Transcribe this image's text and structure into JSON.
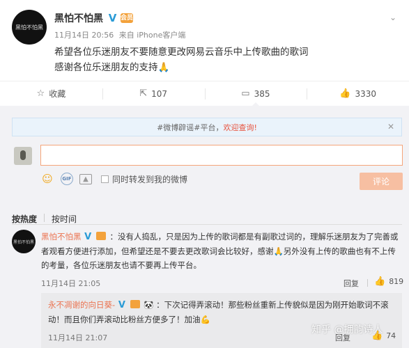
{
  "post": {
    "avatar_text": "黑怕不怕黑",
    "author": "黑怕不怕黑",
    "verified_mark": "V",
    "level_badge": "会员",
    "timestamp": "11月14日 20:56",
    "source_prefix": "来自",
    "source": "iPhone客户端",
    "line1": "希望各位乐迷朋友不要随意更改网易云音乐中上传歌曲的歌词",
    "line2": "感谢各位乐迷朋友的支持🙏",
    "menu_icon": "chevron-down-icon"
  },
  "actions": {
    "favorite_label": "收藏",
    "repost_count": "107",
    "comment_count": "385",
    "like_count": "3330"
  },
  "notice": {
    "prefix": "#微博辟谣#平台，",
    "link": "欢迎查询!",
    "close": "✕"
  },
  "composer": {
    "input_value": "",
    "repost_label": "同时转发到我的微博",
    "submit_label": "评论"
  },
  "sort": {
    "by_hot": "按热度",
    "by_time": "按时间"
  },
  "comment": {
    "author": "黑怕不怕黑",
    "text": "：没有人捣乱，只是因为上传的歌词都是有副歌过词的，理解乐迷朋友为了完善或者观看方便进行添加，但希望还是不要去更改歌词会比较好，感谢🙏另外没有上传的歌曲也有不上传的考量，各位乐迷朋友也请不要再上传平台。",
    "time": "11月14日 21:05",
    "reply_label": "回复",
    "like_count": "819"
  },
  "sub_comment": {
    "author": "永不凋谢的向日葵-",
    "text": "：下次记得弄滚动！那些粉丝重新上传貌似是因为刚开始歌词不滚动！而且你们弄滚动比粉丝方便多了！加油💪",
    "time": "11月14日 21:07",
    "reply_label": "回复",
    "like_count": "74"
  },
  "watermark": "知乎 @拥韵诗人",
  "colors": {
    "accent_orange": "#eb7350",
    "verified_blue": "#2a9bd6",
    "comment_bg": "#f2f2f5",
    "submit_disabled": "#f7bfa2"
  }
}
